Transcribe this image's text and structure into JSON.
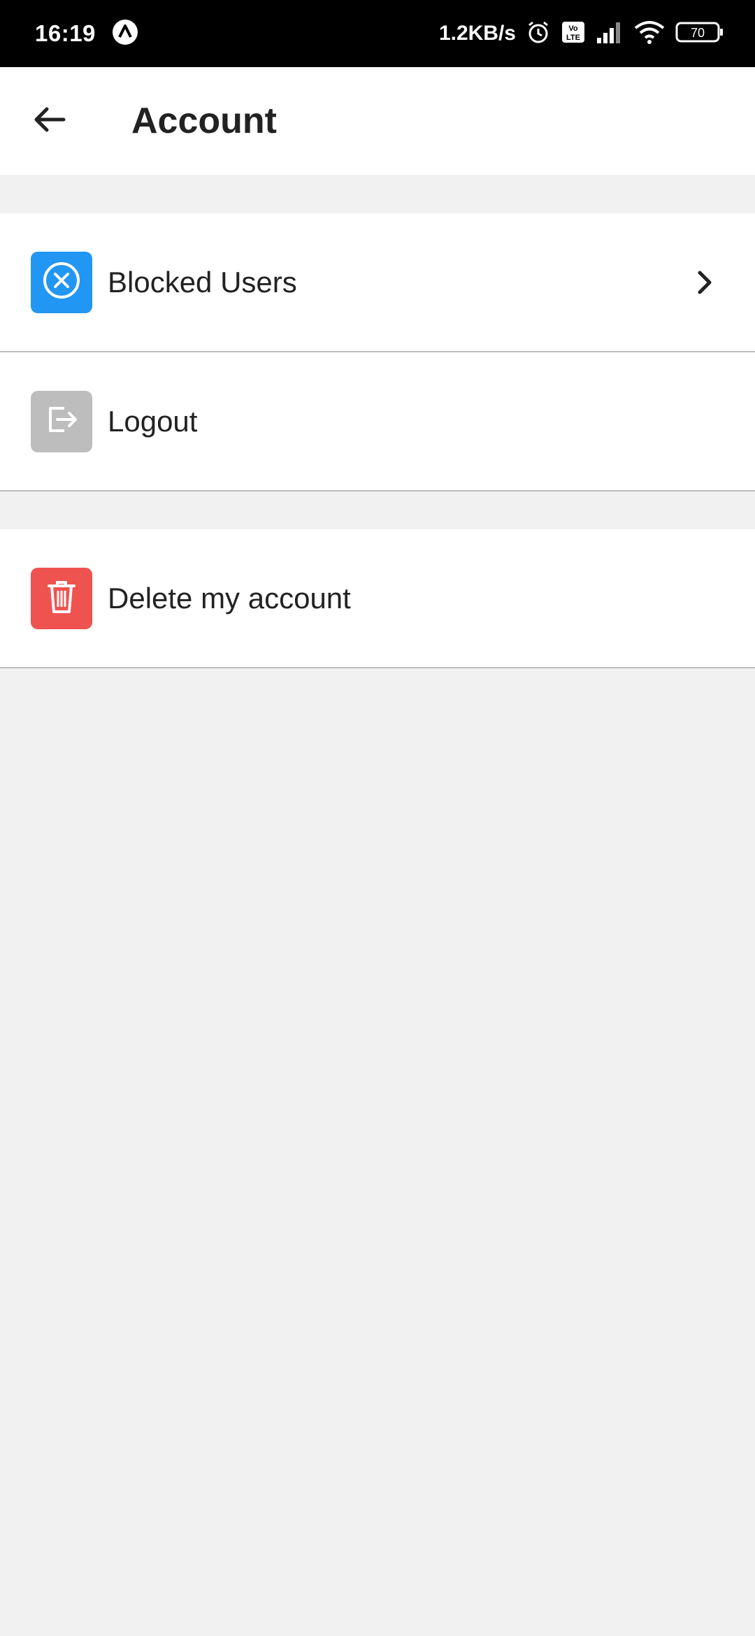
{
  "status_bar": {
    "time": "16:19",
    "network_speed": "1.2KB/s",
    "battery": "70",
    "icons": [
      "nav-arrow-icon",
      "alarm-icon",
      "volte-icon",
      "signal-icon",
      "wifi-icon",
      "battery-icon"
    ]
  },
  "app_bar": {
    "title": "Account",
    "back_icon": "arrow-left-icon"
  },
  "groups": [
    {
      "items": [
        {
          "label": "Blocked Users",
          "icon": "x-circle-icon",
          "icon_color": "#2196f3",
          "has_chevron": true
        },
        {
          "label": "Logout",
          "icon": "logout-icon",
          "icon_color": "#bdbdbd",
          "has_chevron": false
        }
      ]
    },
    {
      "items": [
        {
          "label": "Delete my account",
          "icon": "trash-icon",
          "icon_color": "#ef5350",
          "has_chevron": false
        }
      ]
    }
  ],
  "colors": {
    "background": "#f1f1f1",
    "surface": "#ffffff",
    "divider": "#bdbdbd",
    "text": "#222222"
  }
}
